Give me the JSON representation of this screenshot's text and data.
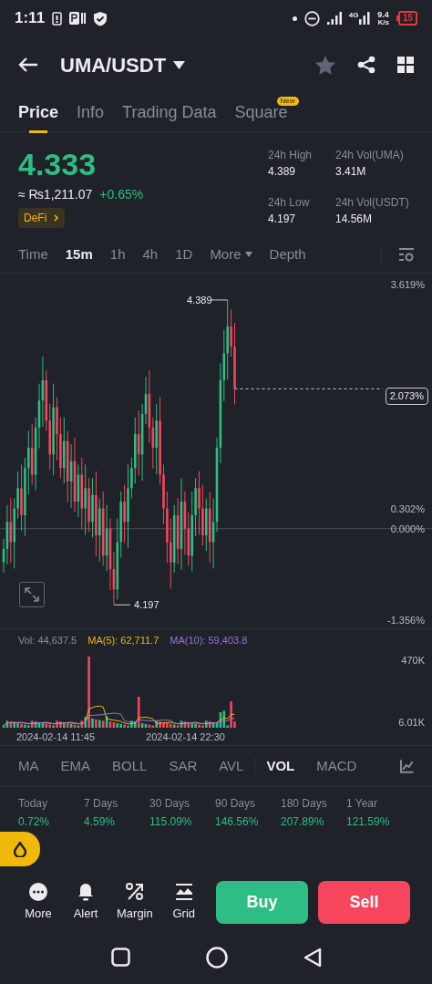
{
  "status_bar": {
    "time": "1:11",
    "network": "4G",
    "speed": "9.4",
    "speed_unit": "K/s",
    "battery": "15"
  },
  "header": {
    "pair": "UMA/USDT"
  },
  "tabs": [
    {
      "label": "Price",
      "selected": true
    },
    {
      "label": "Info",
      "selected": false
    },
    {
      "label": "Trading Data",
      "selected": false
    },
    {
      "label": "Square",
      "selected": false,
      "badge": "New"
    }
  ],
  "price": {
    "last": "4.333",
    "fiat": "≈ ₨1,211.07",
    "change": "+0.65%",
    "tag": "DeFi"
  },
  "stats": [
    {
      "label": "24h High",
      "value": "4.389"
    },
    {
      "label": "24h Vol(UMA)",
      "value": "3.41M"
    },
    {
      "label": "24h Low",
      "value": "4.197"
    },
    {
      "label": "24h Vol(USDT)",
      "value": "14.56M"
    }
  ],
  "intervals": [
    {
      "label": "Time",
      "selected": false,
      "kind": "plain"
    },
    {
      "label": "15m",
      "selected": true,
      "kind": "plain"
    },
    {
      "label": "1h",
      "selected": false,
      "kind": "plain"
    },
    {
      "label": "4h",
      "selected": false,
      "kind": "plain"
    },
    {
      "label": "1D",
      "selected": false,
      "kind": "plain"
    },
    {
      "label": "More",
      "selected": false,
      "kind": "dropdown"
    },
    {
      "label": "Depth",
      "selected": false,
      "kind": "plain"
    }
  ],
  "chart": {
    "high_label": "4.389",
    "low_label": "4.197",
    "current_label": "2.073%",
    "y_labels": [
      "3.619%",
      "0.302%",
      "0.000%",
      "-1.356%"
    ]
  },
  "volume": {
    "legend": [
      {
        "label": "Vol: 44,637.5",
        "color": "#8a8f98"
      },
      {
        "label": "MA(5): 62,711.7",
        "color": "#f0b90b"
      },
      {
        "label": "MA(10): 59,403.8",
        "color": "#9b74d8"
      }
    ],
    "y_labels": [
      "470K",
      "6.01K"
    ],
    "dates": [
      "2024-02-14 11:45",
      "2024-02-14 22:30"
    ]
  },
  "indicators": [
    {
      "label": "MA",
      "selected": false
    },
    {
      "label": "EMA",
      "selected": false
    },
    {
      "label": "BOLL",
      "selected": false
    },
    {
      "label": "SAR",
      "selected": false
    },
    {
      "label": "AVL",
      "selected": false
    },
    {
      "label": "VOL",
      "selected": true
    },
    {
      "label": "MACD",
      "selected": false
    }
  ],
  "performance": [
    {
      "period": "Today",
      "change": "0.72%"
    },
    {
      "period": "7 Days",
      "change": "4.59%"
    },
    {
      "period": "30 Days",
      "change": "115.09%"
    },
    {
      "period": "90 Days",
      "change": "146.56%"
    },
    {
      "period": "180 Days",
      "change": "207.89%"
    },
    {
      "period": "1 Year",
      "change": "121.59%"
    }
  ],
  "actions": [
    {
      "label": "More",
      "kind": "more"
    },
    {
      "label": "Alert",
      "kind": "alert"
    },
    {
      "label": "Margin",
      "kind": "margin"
    },
    {
      "label": "Grid",
      "kind": "grid"
    }
  ],
  "buy": "Buy",
  "sell": "Sell"
}
